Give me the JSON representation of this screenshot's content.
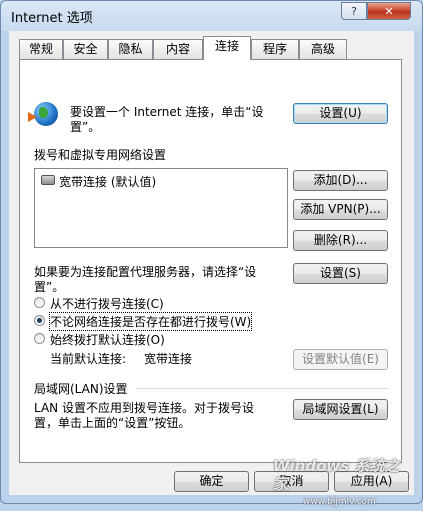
{
  "window": {
    "title": "Internet 选项",
    "help": "?",
    "close": "✕"
  },
  "tabs": [
    {
      "label": "常规"
    },
    {
      "label": "安全"
    },
    {
      "label": "隐私"
    },
    {
      "label": "内容"
    },
    {
      "label": "连接",
      "active": true
    },
    {
      "label": "程序"
    },
    {
      "label": "高级"
    }
  ],
  "setup": {
    "text1": "要设置一个 Internet 连接，单击“设",
    "text2": "置”。",
    "button": "设置(U)"
  },
  "dialup": {
    "heading": "拨号和虚拟专用网络设置",
    "items": [
      {
        "label": "宽带连接 (默认值)"
      }
    ],
    "add": "添加(D)...",
    "add_vpn": "添加 VPN(P)...",
    "delete": "删除(R)...",
    "proxy_text1": "如果要为连接配置代理服务器，请选择“设",
    "proxy_text2": "置”。",
    "settings": "设置(S)",
    "options": [
      {
        "label": "从不进行拨号连接(C)",
        "checked": false
      },
      {
        "label": "不论网络连接是否存在都进行拨号(W)",
        "checked": true
      },
      {
        "label": "始终拨打默认连接(O)",
        "checked": false
      }
    ],
    "current_default_label": "当前默认连接:",
    "current_default_value": "宽带连接",
    "set_default": "设置默认值(E)"
  },
  "lan": {
    "heading": "局域网(LAN)设置",
    "text1": "LAN 设置不应用到拨号连接。对于拨号设",
    "text2": "置，单击上面的“设置”按钮。",
    "button": "局域网设置(L)"
  },
  "footer": {
    "ok": "确定",
    "cancel": "取消",
    "apply": "应用(A)"
  },
  "watermark": {
    "line1": "Windows 系统之家",
    "line2": "www.bjjmlv.com"
  }
}
